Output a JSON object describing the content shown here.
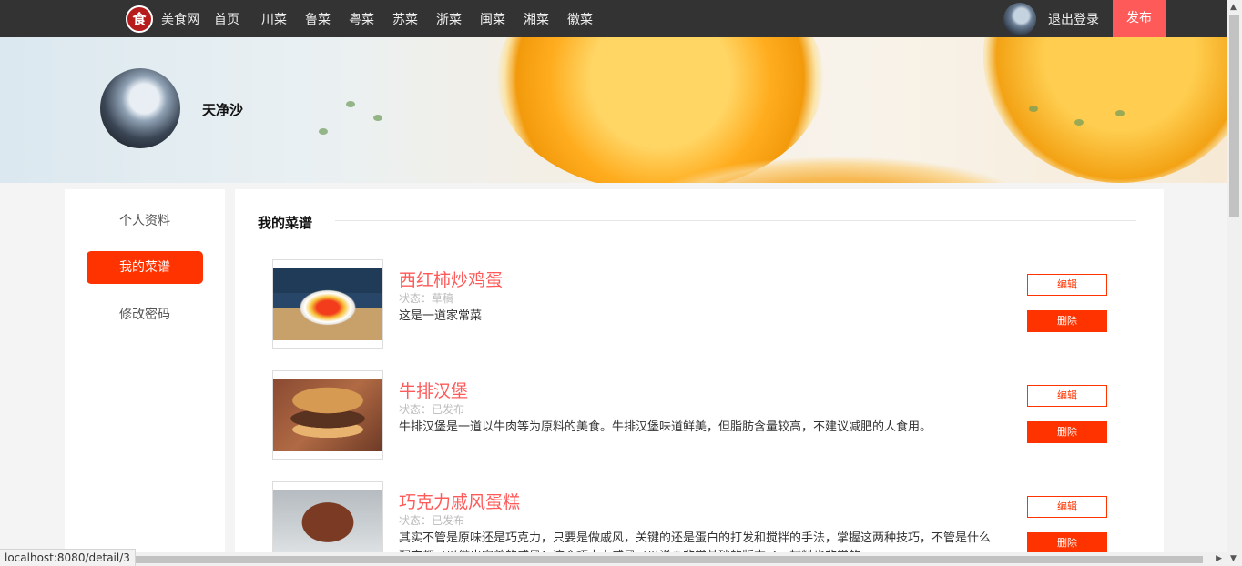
{
  "nav": {
    "logo_glyph": "食",
    "brand": "美食网",
    "items": [
      "首页",
      "川菜",
      "鲁菜",
      "粤菜",
      "苏菜",
      "浙菜",
      "闽菜",
      "湘菜",
      "徽菜"
    ],
    "logout": "退出登录",
    "publish": "发布"
  },
  "profile": {
    "name": "天净沙"
  },
  "sidebar": {
    "items": [
      {
        "label": "个人资料",
        "active": false
      },
      {
        "label": "我的菜谱",
        "active": true
      },
      {
        "label": "修改密码",
        "active": false
      }
    ]
  },
  "main": {
    "title": "我的菜谱",
    "recipes": [
      {
        "title": "西红柿炒鸡蛋",
        "status": "状态：草稿",
        "desc": "这是一道家常菜",
        "edit": "编辑",
        "delete": "删除"
      },
      {
        "title": "牛排汉堡",
        "status": "状态：已发布",
        "desc": "牛排汉堡是一道以牛肉等为原料的美食。牛排汉堡味道鲜美，但脂肪含量较高，不建议减肥的人食用。",
        "edit": "编辑",
        "delete": "删除"
      },
      {
        "title": "巧克力戚风蛋糕",
        "status": "状态：已发布",
        "desc": "其实不管是原味还是巧克力，只要是做戚风，关键的还是蛋白的打发和搅拌的手法，掌握这两种技巧，不管是什么配方都可以做出完美的戚风！这个巧克力戚风可以说真非常基础的版本了，材料也非常的",
        "edit": "编辑",
        "delete": "删除"
      }
    ]
  },
  "status_bar": {
    "url": "localhost:8080/detail/3"
  },
  "colors": {
    "accent": "#ff3300",
    "title_red": "#ff5a5a",
    "topbar": "#333333"
  }
}
